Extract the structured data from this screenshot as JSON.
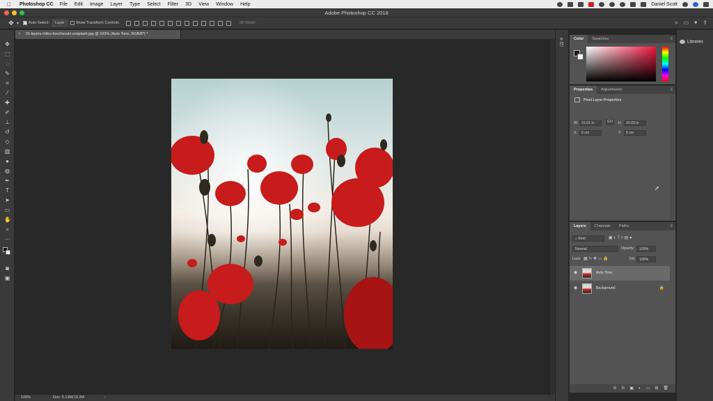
{
  "menubar": {
    "app": "Photoshop CC",
    "items": [
      "File",
      "Edit",
      "Image",
      "Layer",
      "Type",
      "Select",
      "Filter",
      "3D",
      "View",
      "Window",
      "Help"
    ],
    "user": "Daniel Scott"
  },
  "window": {
    "title": "Adobe Photoshop CC 2018"
  },
  "options": {
    "auto_select_label": "Auto-Select:",
    "auto_select_value": "Layer",
    "show_transform_label": "Show Transform Controls",
    "mode_3d_label": "3D Mode:"
  },
  "document": {
    "tab": "01-layers-milos-tonchevski-unsplash.jpg @ 100% (Auto Tone, RGB/8*) *"
  },
  "status": {
    "zoom": "100%",
    "doc": "Doc: 5.13M/10.3M",
    "arrow": "›"
  },
  "color_panel": {
    "tabs": [
      "Color",
      "Swatches"
    ]
  },
  "properties_panel": {
    "tabs": [
      "Properties",
      "Adjustments"
    ],
    "title": "Pixel Layer Properties",
    "w_label": "W:",
    "w_value": "16.01 in",
    "h_label": "H:",
    "h_value": "20.03 in",
    "x_label": "X:",
    "x_value": "0 cm",
    "y_label": "Y:",
    "y_value": "0 cm",
    "link": "GO"
  },
  "layers_panel": {
    "tabs": [
      "Layers",
      "Channels",
      "Paths"
    ],
    "filter": "Kind",
    "blend_mode": "Normal",
    "opacity_label": "Opacity:",
    "opacity_value": "100%",
    "lock_label": "Lock:",
    "fill_label": "Fill:",
    "fill_value": "100%",
    "layers": [
      {
        "name": "Auto Tone",
        "active": true
      },
      {
        "name": "Background",
        "active": false
      }
    ],
    "footer_icons": [
      "link-icon",
      "fx-icon",
      "mask-icon",
      "adjustment-icon",
      "group-icon",
      "new-layer-icon",
      "trash-icon"
    ],
    "footer_labels": [
      "⊝",
      "fx",
      "▣",
      "◐",
      "▭",
      "⊞",
      "🗑"
    ]
  },
  "libraries": {
    "label": "Libraries"
  },
  "colors": {
    "accent_red": "#f0163d",
    "panel_bg": "#535353",
    "chrome_bg": "#3a3a3a"
  }
}
